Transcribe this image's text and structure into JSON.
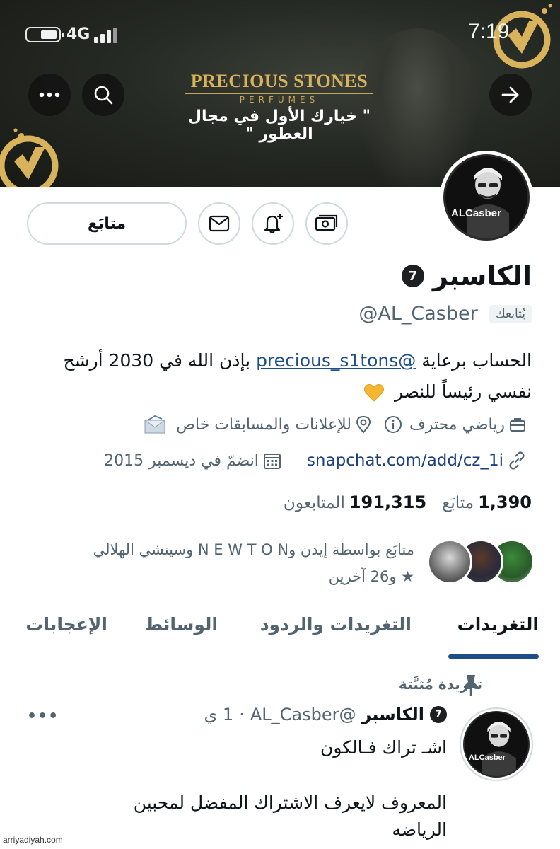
{
  "status_bar": {
    "network": "4G",
    "time": "7:19"
  },
  "banner": {
    "brand_name": "PRECIOUS STONES",
    "brand_sub": "PERFUMES",
    "tagline": "\" خيارك الأول في مجال العطور \""
  },
  "avatar": {
    "text": "ALCasber"
  },
  "profile": {
    "follow_button": "متابَع",
    "display_name": "الكاسبر",
    "verified_glyph": "7",
    "handle": "@AL_Casber",
    "follows_you": "يُتابعك",
    "bio_before": "الحساب برعاية ",
    "bio_mention": "@precious_s1tons",
    "bio_after": " بإذن الله في 2030 أرشح نفسي رئيساً للنصر",
    "category": "رياضي محترف",
    "location": "للإعلانات والمسابقات خاص",
    "link": "snapchat.com/add/cz_1i",
    "joined": "انضمّ في ديسمبر 2015",
    "following_count": "1,390",
    "following_label": "متابَع",
    "followers_count": "191,315",
    "followers_label": "المتابعون",
    "followed_by_line1": "متابَع بواسطة إيدن وN E W T O N وسينشي الهلالي",
    "followed_by_line2": "★ و26 آخرين"
  },
  "tabs": [
    {
      "label": "التغريدات",
      "active": true
    },
    {
      "label": "التغريدات والردود",
      "active": false
    },
    {
      "label": "الوسائط",
      "active": false
    },
    {
      "label": "الإعجابات",
      "active": false
    }
  ],
  "pinned_tweet": {
    "pinned_label": "تغريدة مُثبَّتة",
    "author_name": "الكاسبر",
    "author_handle": "@AL_Casber",
    "separator": "·",
    "time": "1 ي",
    "line1": "اشـ تراك فـالكون",
    "line2": "المعروف لايعرف الاشتراك المفضل لمحبين",
    "line3": "الرياضه",
    "more": "•••"
  },
  "watermark": "arriyadiyah.com",
  "colors": {
    "link": "#1d3f7a",
    "tab_indicator": "#1d4e89",
    "brand_gold": "#d9b35c",
    "secondary_text": "#536471"
  }
}
